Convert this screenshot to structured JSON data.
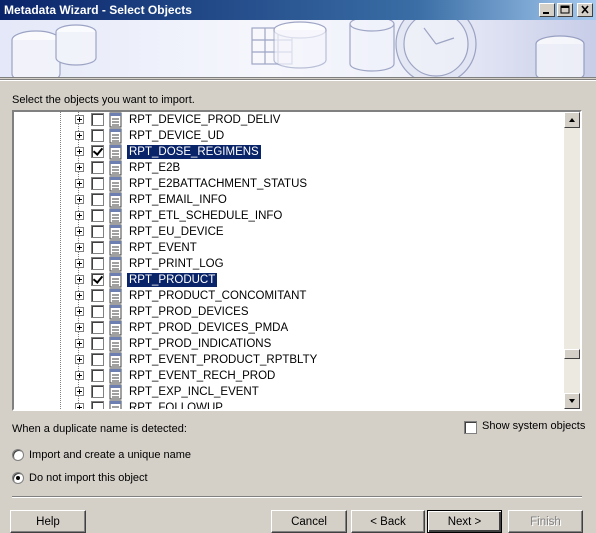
{
  "window": {
    "title": "Metadata Wizard - Select Objects"
  },
  "prompt": "Select the objects you want to import.",
  "tree_items": [
    {
      "label": "RPT_DEVICE_PROD_DELIV",
      "checked": false,
      "selected": false
    },
    {
      "label": "RPT_DEVICE_UD",
      "checked": false,
      "selected": false
    },
    {
      "label": "RPT_DOSE_REGIMENS",
      "checked": true,
      "selected": true
    },
    {
      "label": "RPT_E2B",
      "checked": false,
      "selected": false
    },
    {
      "label": "RPT_E2BATTACHMENT_STATUS",
      "checked": false,
      "selected": false
    },
    {
      "label": "RPT_EMAIL_INFO",
      "checked": false,
      "selected": false
    },
    {
      "label": "RPT_ETL_SCHEDULE_INFO",
      "checked": false,
      "selected": false
    },
    {
      "label": "RPT_EU_DEVICE",
      "checked": false,
      "selected": false
    },
    {
      "label": "RPT_EVENT",
      "checked": false,
      "selected": false
    },
    {
      "label": "RPT_PRINT_LOG",
      "checked": false,
      "selected": false
    },
    {
      "label": "RPT_PRODUCT",
      "checked": true,
      "selected": true
    },
    {
      "label": "RPT_PRODUCT_CONCOMITANT",
      "checked": false,
      "selected": false
    },
    {
      "label": "RPT_PROD_DEVICES",
      "checked": false,
      "selected": false
    },
    {
      "label": "RPT_PROD_DEVICES_PMDA",
      "checked": false,
      "selected": false
    },
    {
      "label": "RPT_PROD_INDICATIONS",
      "checked": false,
      "selected": false
    },
    {
      "label": "RPT_EVENT_PRODUCT_RPTBLTY",
      "checked": false,
      "selected": false
    },
    {
      "label": "RPT_EVENT_RECH_PROD",
      "checked": false,
      "selected": false
    },
    {
      "label": "RPT_EXP_INCL_EVENT",
      "checked": false,
      "selected": false
    },
    {
      "label": "RPT_FOLLOWUP",
      "checked": false,
      "selected": false
    }
  ],
  "duplicate": {
    "label": "When a duplicate name is detected:",
    "options": [
      {
        "label": "Import and create a unique name",
        "selected": false
      },
      {
        "label": "Do not import this object",
        "selected": true
      }
    ]
  },
  "show_system": {
    "label": "Show system objects",
    "checked": false
  },
  "buttons": {
    "help": "Help",
    "cancel": "Cancel",
    "back": "< Back",
    "next": "Next >",
    "finish": "Finish"
  }
}
